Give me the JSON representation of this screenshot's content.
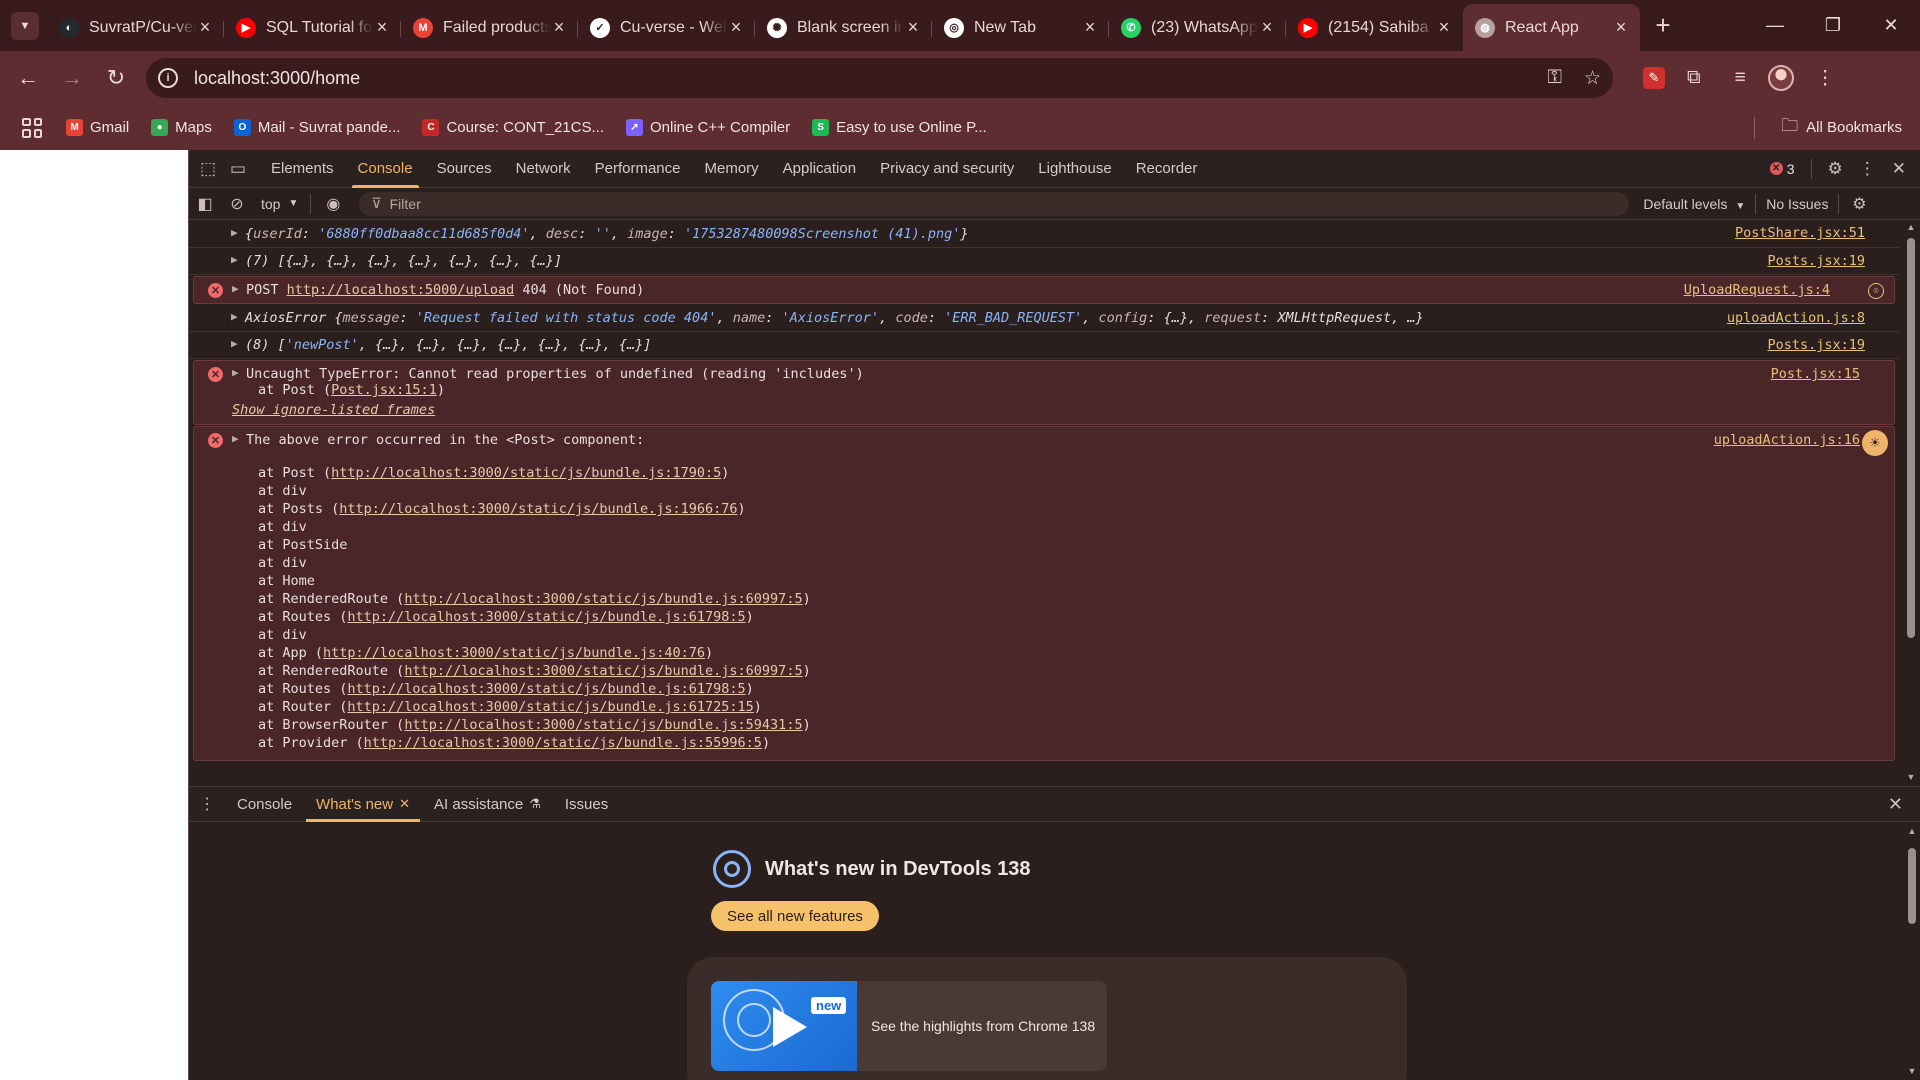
{
  "browser": {
    "tabs": [
      {
        "title": "SuvratP/Cu-verse",
        "icon": "github-icon",
        "color": "#24292f",
        "glyph": "◐"
      },
      {
        "title": "SQL Tutorial for",
        "icon": "youtube-icon",
        "color": "#ff0000",
        "glyph": "▶"
      },
      {
        "title": "Failed products",
        "icon": "gmail-icon",
        "color": "#ea4335",
        "glyph": "M"
      },
      {
        "title": "Cu-verse - WebStorm",
        "icon": "checklist-icon",
        "color": "#ffffff",
        "glyph": "✓"
      },
      {
        "title": "Blank screen in React",
        "icon": "openai-icon",
        "color": "#ffffff",
        "glyph": "✺"
      },
      {
        "title": "New Tab",
        "icon": "chrome-icon",
        "color": "#ffffff",
        "glyph": "◎"
      },
      {
        "title": "(23) WhatsApp",
        "icon": "whatsapp-icon",
        "color": "#25d366",
        "glyph": "✆"
      },
      {
        "title": "(2154) Sahiba",
        "icon": "youtube-icon",
        "color": "#ff0000",
        "glyph": "▶"
      },
      {
        "title": "React App",
        "icon": "globe-icon",
        "color": "#b8a0a0",
        "glyph": "◍",
        "active": true
      }
    ],
    "url": "localhost:3000/home",
    "bookmarks": [
      {
        "label": "Gmail",
        "icon": "gmail-icon",
        "color": "#ea4335",
        "glyph": "M"
      },
      {
        "label": "Maps",
        "icon": "maps-pin-icon",
        "color": "#34a853",
        "glyph": "●"
      },
      {
        "label": "Mail - Suvrat pande...",
        "icon": "outlook-icon",
        "color": "#0a64d6",
        "glyph": "O"
      },
      {
        "label": "Course: CONT_21CS...",
        "icon": "course-icon",
        "color": "#c62828",
        "glyph": "C"
      },
      {
        "label": "Online C++ Compiler",
        "icon": "compiler-icon",
        "color": "#7b61ff",
        "glyph": "↗"
      },
      {
        "label": "Easy to use Online P...",
        "icon": "s-logo-icon",
        "color": "#1db954",
        "glyph": "S"
      }
    ],
    "all_bookmarks": "All Bookmarks"
  },
  "devtools": {
    "tabs": [
      "Elements",
      "Console",
      "Sources",
      "Network",
      "Performance",
      "Memory",
      "Application",
      "Privacy and security",
      "Lighthouse",
      "Recorder"
    ],
    "active_tab": "Console",
    "error_count": "3",
    "context": "top",
    "filter_placeholder": "Filter",
    "levels": "Default levels",
    "issues": "No Issues",
    "console": {
      "log1_src": "PostShare.jsx:51",
      "log2_text": "(7) [{…}, {…}, {…}, {…}, {…}, {…}, {…}]",
      "log2_src": "Posts.jsx:19",
      "err1_prefix": "POST",
      "err1_url": "http://localhost:5000/upload",
      "err1_status": "404 (Not Found)",
      "err1_src": "UploadRequest.js:4",
      "log3_src": "uploadAction.js:8",
      "log4_src": "Posts.jsx:19",
      "err2_line1": "Uncaught TypeError: Cannot read properties of undefined (reading 'includes')",
      "err2_at": "at Post (",
      "err2_loc": "Post.jsx:15:1",
      "err2_close": ")",
      "err2_show": "Show ignore-listed frames",
      "err2_src": "Post.jsx:15",
      "err3_line1": "The above error occurred in the <Post> component:",
      "err3_src": "uploadAction.js:16",
      "stack": [
        {
          "pre": "at Post (",
          "link": "http://localhost:3000/static/js/bundle.js:1790:5",
          "post": ")"
        },
        {
          "pre": "at div",
          "link": "",
          "post": ""
        },
        {
          "pre": "at Posts (",
          "link": "http://localhost:3000/static/js/bundle.js:1966:76",
          "post": ")"
        },
        {
          "pre": "at div",
          "link": "",
          "post": ""
        },
        {
          "pre": "at PostSide",
          "link": "",
          "post": ""
        },
        {
          "pre": "at div",
          "link": "",
          "post": ""
        },
        {
          "pre": "at Home",
          "link": "",
          "post": ""
        },
        {
          "pre": "at RenderedRoute (",
          "link": "http://localhost:3000/static/js/bundle.js:60997:5",
          "post": ")"
        },
        {
          "pre": "at Routes (",
          "link": "http://localhost:3000/static/js/bundle.js:61798:5",
          "post": ")"
        },
        {
          "pre": "at div",
          "link": "",
          "post": ""
        },
        {
          "pre": "at App (",
          "link": "http://localhost:3000/static/js/bundle.js:40:76",
          "post": ")"
        },
        {
          "pre": "at RenderedRoute (",
          "link": "http://localhost:3000/static/js/bundle.js:60997:5",
          "post": ")"
        },
        {
          "pre": "at Routes (",
          "link": "http://localhost:3000/static/js/bundle.js:61798:5",
          "post": ")"
        },
        {
          "pre": "at Router (",
          "link": "http://localhost:3000/static/js/bundle.js:61725:15",
          "post": ")"
        },
        {
          "pre": "at BrowserRouter (",
          "link": "http://localhost:3000/static/js/bundle.js:59431:5",
          "post": ")"
        },
        {
          "pre": "at Provider (",
          "link": "http://localhost:3000/static/js/bundle.js:55996:5",
          "post": ")"
        }
      ]
    },
    "drawer": {
      "tabs": [
        "Console",
        "What's new",
        "AI assistance",
        "Issues"
      ],
      "active": "What's new"
    },
    "whats_new": {
      "title": "What's new in DevTools 138",
      "button": "See all new features",
      "badge": "new",
      "card_text": "See the highlights from Chrome 138"
    }
  }
}
